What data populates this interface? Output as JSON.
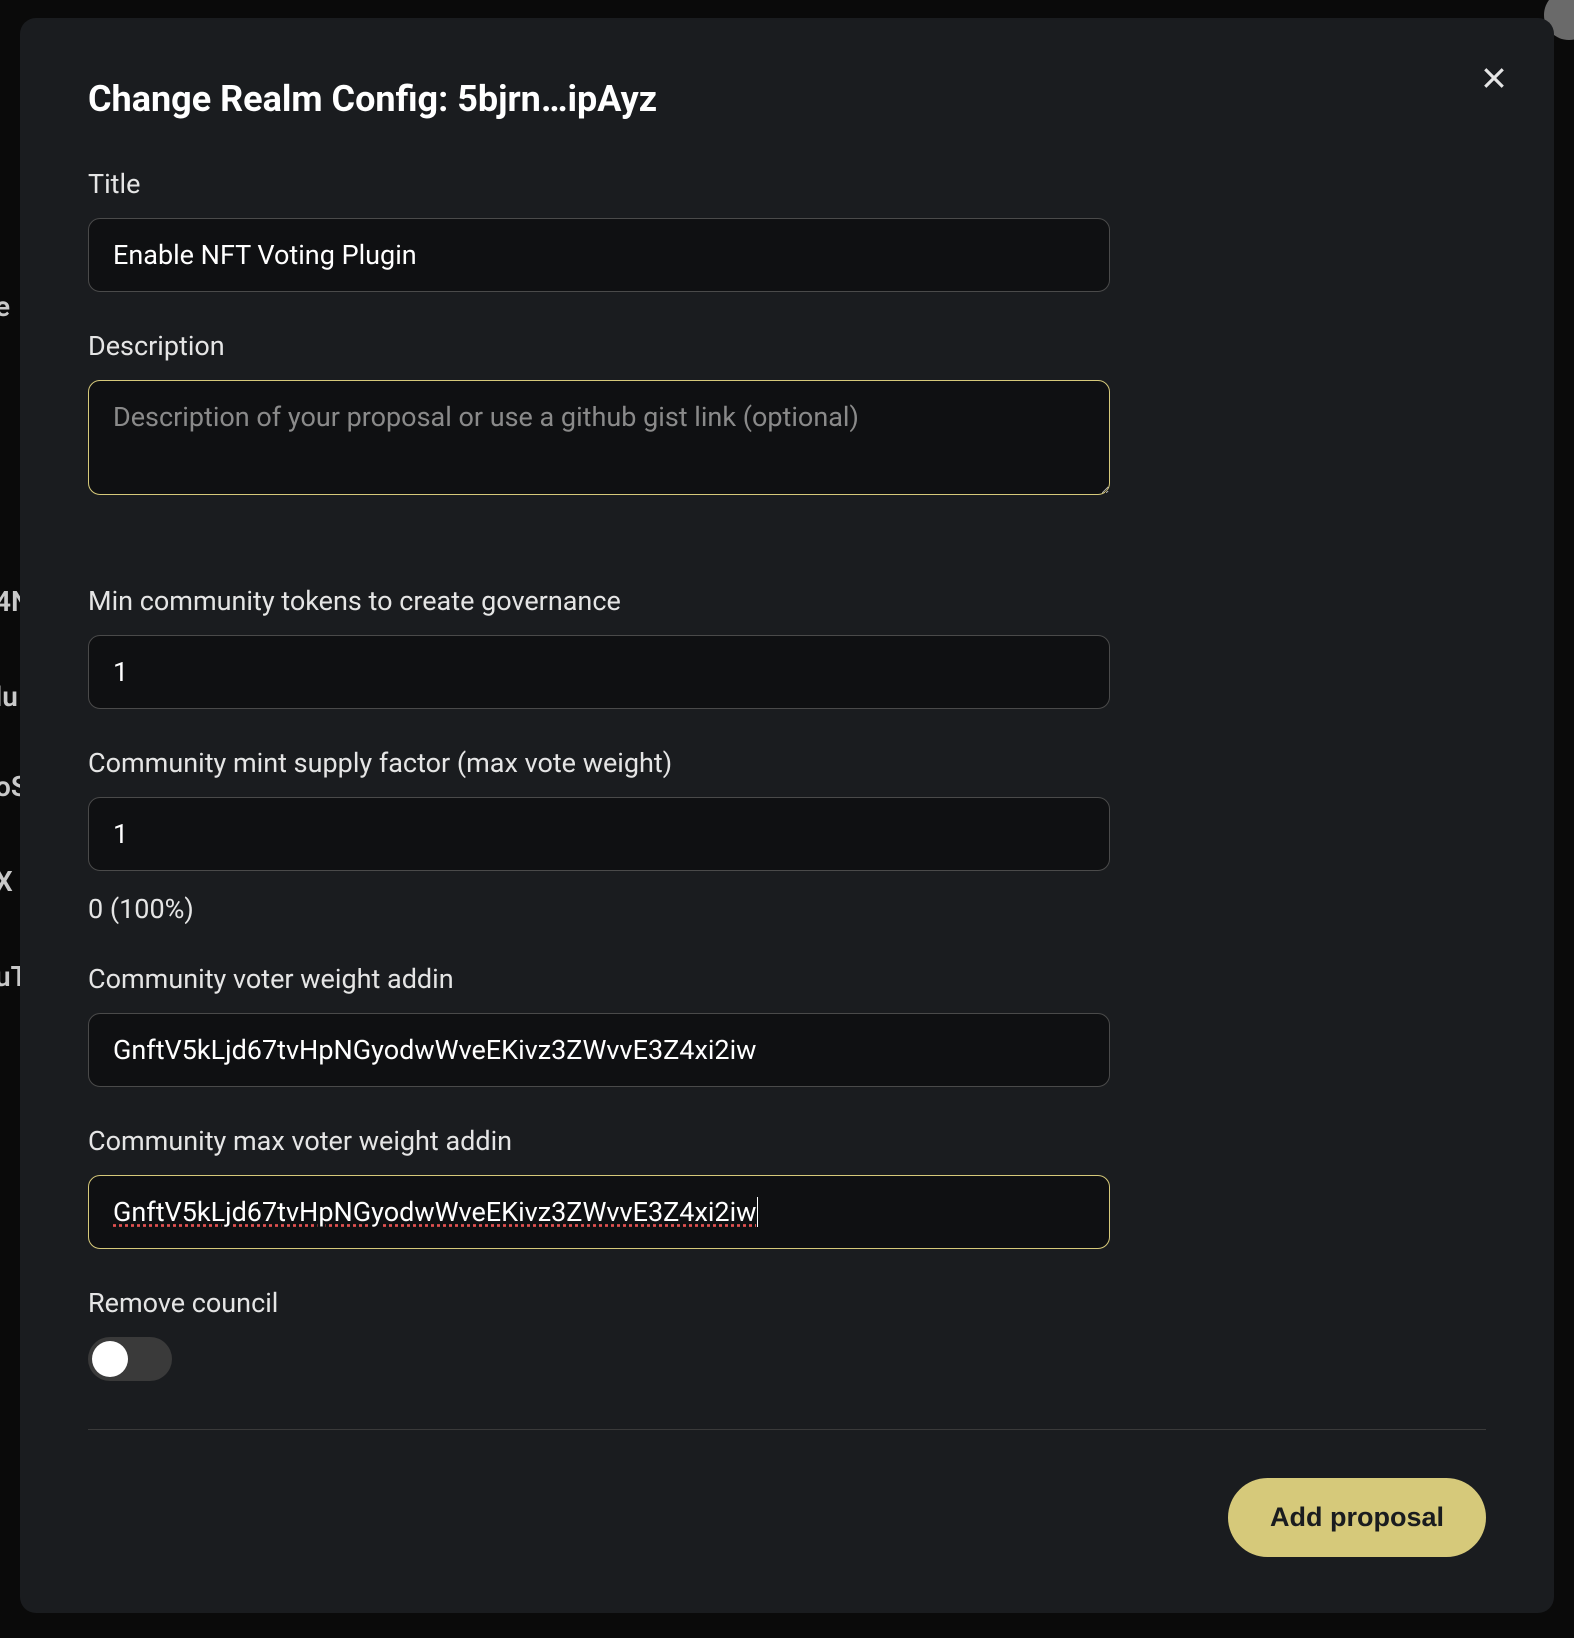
{
  "bg": {
    "row1": "e",
    "row2": "4N",
    "row3": "lu",
    "row4": "oS",
    "row5": "X",
    "row6": "uT"
  },
  "modal": {
    "title": "Change Realm Config: 5bjrn…ipAyz",
    "fields": {
      "title": {
        "label": "Title",
        "value": "Enable NFT Voting Plugin"
      },
      "description": {
        "label": "Description",
        "placeholder": "Description of your proposal or use a github gist link (optional)",
        "value": ""
      },
      "minTokens": {
        "label": "Min community tokens to create governance",
        "value": "1"
      },
      "supplyFactor": {
        "label": "Community mint supply factor (max vote weight)",
        "value": "1",
        "note": "0 (100%)"
      },
      "voterWeight": {
        "label": "Community voter weight addin",
        "value": "GnftV5kLjd67tvHpNGyodwWveEKivz3ZWvvE3Z4xi2iw"
      },
      "maxVoterWeight": {
        "label": "Community max voter weight addin",
        "value": "GnftV5kLjd67tvHpNGyodwWveEKivz3ZWvvE3Z4xi2iw"
      },
      "removeCouncil": {
        "label": "Remove council",
        "value": false
      }
    },
    "submit": "Add proposal"
  }
}
